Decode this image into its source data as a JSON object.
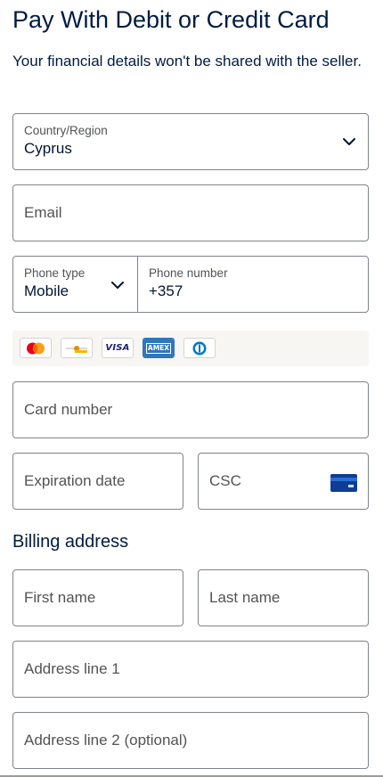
{
  "header": {
    "title": "Pay With Debit or Credit Card",
    "subtitle": "Your financial details won't be shared with the seller."
  },
  "country": {
    "label": "Country/Region",
    "value": "Cyprus",
    "icon": "chevron-down-icon"
  },
  "email": {
    "placeholder": "Email"
  },
  "phone": {
    "type_label": "Phone type",
    "type_value": "Mobile",
    "number_label": "Phone number",
    "number_value": "+357"
  },
  "card_brands": [
    {
      "name": "mastercard",
      "icon": "mastercard-icon"
    },
    {
      "name": "maestro",
      "icon": "maestro-icon"
    },
    {
      "name": "visa",
      "icon": "visa-icon",
      "text": "VISA"
    },
    {
      "name": "amex",
      "icon": "amex-icon",
      "text": "AMEX"
    },
    {
      "name": "diners",
      "icon": "diners-club-icon"
    }
  ],
  "card": {
    "number_placeholder": "Card number",
    "expiration_placeholder": "Expiration date",
    "csc_placeholder": "CSC",
    "csc_icon": "card-back-icon"
  },
  "billing": {
    "section_title": "Billing address",
    "first_name_placeholder": "First name",
    "last_name_placeholder": "Last name",
    "address1_placeholder": "Address line 1",
    "address2_placeholder": "Address line 2 (optional)"
  },
  "colors": {
    "text": "#001c40",
    "border": "#7d8489",
    "placeholder": "#515354",
    "strip_bg": "#f8f6f2"
  }
}
